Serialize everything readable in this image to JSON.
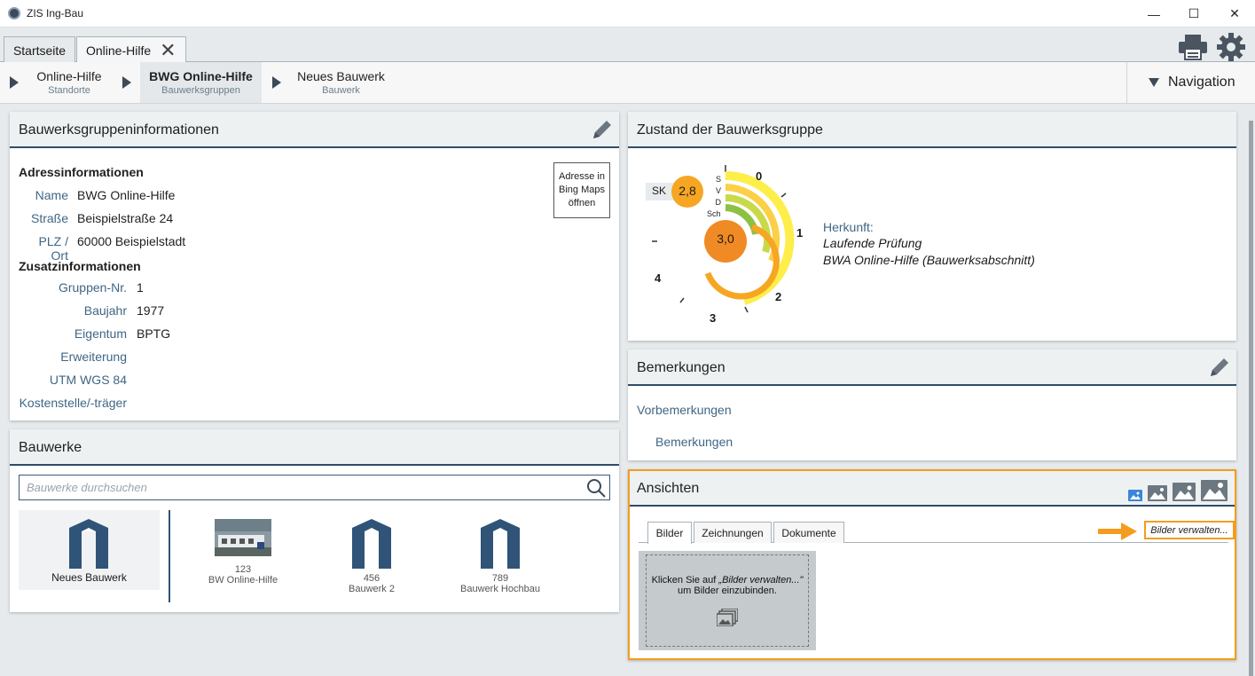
{
  "window": {
    "title": "ZIS Ing-Bau",
    "minimize": "—",
    "maximize": "☐",
    "close": "✕"
  },
  "tabs": [
    {
      "label": "Startseite"
    },
    {
      "label": "Online-Hilfe",
      "close": "✕"
    }
  ],
  "toolbar": {
    "print_icon": "printer-icon",
    "settings_icon": "gear-icon"
  },
  "breadcrumb": [
    {
      "title": "Online-Hilfe",
      "subtitle": "Standorte"
    },
    {
      "title": "BWG Online-Hilfe",
      "subtitle": "Bauwerksgruppen"
    },
    {
      "title": "Neues Bauwerk",
      "subtitle": "Bauwerk"
    }
  ],
  "navigation": {
    "label": "Navigation"
  },
  "group_info": {
    "title": "Bauwerksgruppeninformationen",
    "address_title": "Adressinformationen",
    "address": [
      {
        "label": "Name",
        "value": "BWG Online-Hilfe"
      },
      {
        "label": "Straße",
        "value": "Beispielstraße 24"
      },
      {
        "label": "PLZ / Ort",
        "value": "60000 Beispielstadt"
      }
    ],
    "extra_title": "Zusatzinformationen",
    "extra": [
      {
        "label": "Gruppen-Nr.",
        "value": "1"
      },
      {
        "label": "Baujahr",
        "value": "1977"
      },
      {
        "label": "Eigentum",
        "value": "BPTG"
      },
      {
        "label": "Erweiterung",
        "value": ""
      },
      {
        "label": "UTM WGS 84",
        "value": ""
      },
      {
        "label": "Kostenstelle/-träger",
        "value": ""
      }
    ],
    "bing_line1": "Adresse in",
    "bing_line2": "Bing Maps",
    "bing_line3": "öffnen"
  },
  "bauwerke": {
    "title": "Bauwerke",
    "search_placeholder": "Bauwerke durchsuchen",
    "new_label": "Neues Bauwerk",
    "items": [
      {
        "number": "123",
        "name": "BW Online-Hilfe",
        "kind": "photo"
      },
      {
        "number": "456",
        "name": "Bauwerk 2",
        "kind": "icon"
      },
      {
        "number": "789",
        "name": "Bauwerk Hochbau",
        "kind": "icon"
      }
    ]
  },
  "zustand": {
    "title": "Zustand der Bauwerksgruppe",
    "sk_label": "SK",
    "sk_value": "2,8",
    "center_value": "3,0",
    "ring_labels": [
      "S",
      "V",
      "D",
      "Sch"
    ],
    "scale_labels": [
      "0",
      "1",
      "2",
      "3",
      "4"
    ],
    "herkunft_label": "Herkunft:",
    "herkunft_line1": "Laufende Prüfung",
    "herkunft_line2": "BWA Online-Hilfe (Bauwerksabschnitt)",
    "colors": {
      "yellow": "#fdee4a",
      "lime": "#c8d94a",
      "green": "#8dc043",
      "orange": "#f6a623",
      "dark_orange": "#f08a24"
    }
  },
  "bemerkungen": {
    "title": "Bemerkungen",
    "vorbemerkungen": "Vorbemerkungen",
    "bemerkungen": "Bemerkungen"
  },
  "ansichten": {
    "title": "Ansichten",
    "tabs": [
      "Bilder",
      "Zeichnungen",
      "Dokumente"
    ],
    "manage": "Bilder verwalten...",
    "hint_line1_prefix": "Klicken Sie auf ",
    "hint_line1_em": "„Bilder verwalten...\"",
    "hint_line2": "um Bilder einzubinden.",
    "accent": "#f39c1e"
  }
}
